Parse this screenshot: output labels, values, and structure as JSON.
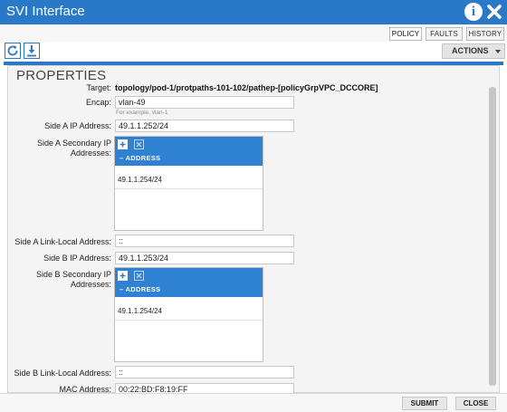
{
  "window": {
    "title": "SVI Interface"
  },
  "tabs": [
    {
      "label": "POLICY",
      "active": true
    },
    {
      "label": "FAULTS",
      "active": false
    },
    {
      "label": "HISTORY",
      "active": false
    }
  ],
  "toolbar": {
    "actions_label": "ACTIONS"
  },
  "properties": {
    "heading": "PROPERTIES",
    "target": {
      "label": "Target:",
      "value": "topology/pod-1/protpaths-101-102/pathep-[policyGrpVPC_DCCORE]"
    },
    "encap": {
      "label": "Encap:",
      "value": "vlan-49",
      "hint": "For example, vlan-1"
    },
    "side_a_ip": {
      "label": "Side A IP Address:",
      "value": "49.1.1.252/24"
    },
    "side_a_secondary": {
      "label_line1": "Side A Secondary IP",
      "label_line2": "Addresses:",
      "column": "ADDRESS",
      "rows": [
        "49.1.1.254/24"
      ]
    },
    "side_a_link_local": {
      "label": "Side A Link-Local Address:",
      "value": "::"
    },
    "side_b_ip": {
      "label": "Side B IP Address:",
      "value": "49.1.1.253/24"
    },
    "side_b_secondary": {
      "label_line1": "Side B Secondary IP",
      "label_line2": "Addresses:",
      "column": "ADDRESS",
      "rows": [
        "49.1.1.254/24"
      ]
    },
    "side_b_link_local": {
      "label": "Side B Link-Local Address:",
      "value": "::"
    },
    "mac": {
      "label": "MAC Address:",
      "value": "00:22:BD:F8:19:FF"
    }
  },
  "footer": {
    "submit_label": "SUBMIT",
    "close_label": "CLOSE"
  },
  "colors": {
    "accent": "#2a79c9",
    "header_blue": "#2e81d3"
  },
  "icons": [
    "info-icon",
    "close-icon",
    "refresh-icon",
    "download-icon",
    "add-icon",
    "delete-icon",
    "chevron-down-icon"
  ]
}
